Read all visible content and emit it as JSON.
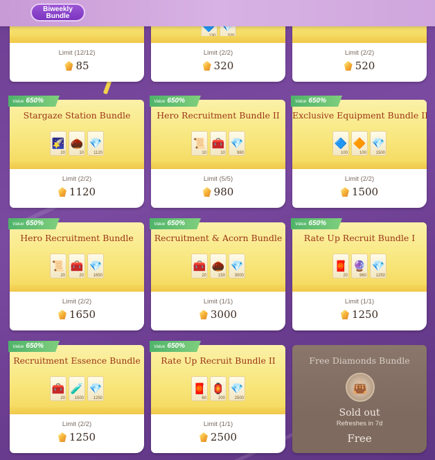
{
  "header": {
    "tab_label": "Biweekly Bundle"
  },
  "top_row": [
    {
      "limit": "Limit (12/12)",
      "price": "85"
    },
    {
      "limit": "Limit (2/2)",
      "price": "320",
      "item_qtys": [
        "130",
        "320"
      ]
    },
    {
      "limit": "Limit (2/2)",
      "price": "520"
    }
  ],
  "bundles": [
    {
      "value_prefix": "Value",
      "value": "650%",
      "title": "Stargaze Station Bundle",
      "limit": "Limit (2/2)",
      "price": "1120",
      "items": [
        {
          "icon": "shooting-star-icon",
          "glyph": "🌠",
          "qty": "20"
        },
        {
          "icon": "acorn-icon",
          "glyph": "🌰",
          "qty": "10"
        },
        {
          "icon": "diamond-icon",
          "glyph": "💎",
          "qty": "1120"
        }
      ]
    },
    {
      "value_prefix": "Value",
      "value": "650%",
      "title": "Hero Recruitment Bundle II",
      "limit": "Limit (5/5)",
      "price": "980",
      "items": [
        {
          "icon": "scroll-icon",
          "glyph": "📜",
          "qty": "10"
        },
        {
          "icon": "chest-icon",
          "glyph": "🧰",
          "qty": "10"
        },
        {
          "icon": "diamond-icon",
          "glyph": "💎",
          "qty": "980"
        }
      ]
    },
    {
      "value_prefix": "Value",
      "value": "650%",
      "title": "Exclusive Equipment Bundle II",
      "limit": "Limit (2/2)",
      "price": "1500",
      "items": [
        {
          "icon": "blue-crystal-icon",
          "glyph": "🔷",
          "qty": "100"
        },
        {
          "icon": "gold-crystal-icon",
          "glyph": "🔶",
          "qty": "100"
        },
        {
          "icon": "diamond-icon",
          "glyph": "💎",
          "qty": "1500"
        }
      ]
    },
    {
      "value_prefix": "Value",
      "value": "650%",
      "title": "Hero Recruitment Bundle",
      "limit": "Limit (2/2)",
      "price": "1650",
      "items": [
        {
          "icon": "scroll-icon",
          "glyph": "📜",
          "qty": "20"
        },
        {
          "icon": "chest-icon",
          "glyph": "🧰",
          "qty": "20"
        },
        {
          "icon": "diamond-icon",
          "glyph": "💎",
          "qty": "1650"
        }
      ]
    },
    {
      "value_prefix": "Value",
      "value": "650%",
      "title": "Recruitment & Acorn Bundle",
      "limit": "Limit (1/1)",
      "price": "3000",
      "items": [
        {
          "icon": "chest-icon",
          "glyph": "🧰",
          "qty": "20"
        },
        {
          "icon": "acorn-icon",
          "glyph": "🌰",
          "qty": "150"
        },
        {
          "icon": "diamond-icon",
          "glyph": "💎",
          "qty": "3000"
        }
      ]
    },
    {
      "value_prefix": "Value",
      "value": "650%",
      "title": "Rate Up Recruit Bundle I",
      "limit": "Limit (1/1)",
      "price": "1250",
      "items": [
        {
          "icon": "red-chest-icon",
          "glyph": "🧧",
          "qty": "20"
        },
        {
          "icon": "blue-orb-icon",
          "glyph": "🔮",
          "qty": "960"
        },
        {
          "icon": "diamond-icon",
          "glyph": "💎",
          "qty": "1250"
        }
      ]
    },
    {
      "value_prefix": "Value",
      "value": "650%",
      "title": "Recruitment Essence Bundle",
      "limit": "Limit (2/2)",
      "price": "1250",
      "items": [
        {
          "icon": "chest-icon",
          "glyph": "🧰",
          "qty": "20"
        },
        {
          "icon": "potion-icon",
          "glyph": "🧪",
          "qty": "1500"
        },
        {
          "icon": "diamond-icon",
          "glyph": "💎",
          "qty": "1250"
        }
      ]
    },
    {
      "value_prefix": "Value",
      "value": "650%",
      "title": "Rate Up Recruit Bundle II",
      "limit": "Limit (1/1)",
      "price": "2500",
      "items": [
        {
          "icon": "red-chest-icon",
          "glyph": "🧧",
          "qty": "60"
        },
        {
          "icon": "lantern-icon",
          "glyph": "🏮",
          "qty": "200"
        },
        {
          "icon": "diamond-icon",
          "glyph": "💎",
          "qty": "2500"
        }
      ]
    }
  ],
  "free_bundle": {
    "title": "Free Diamonds Bundle",
    "status": "Sold out",
    "refresh": "Refreshes in 7d",
    "price": "Free"
  }
}
